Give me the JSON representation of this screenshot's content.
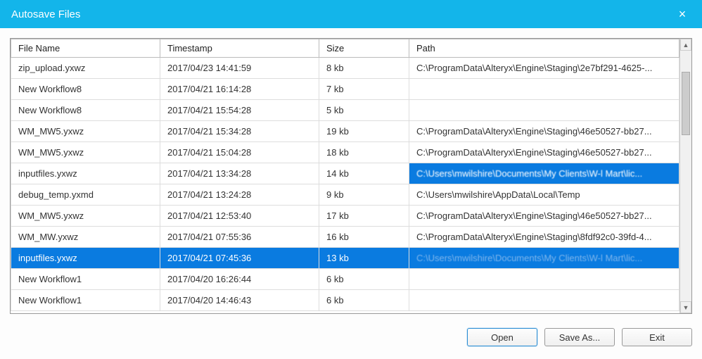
{
  "window": {
    "title": "Autosave Files",
    "close": "×"
  },
  "columns": {
    "name": "File Name",
    "timestamp": "Timestamp",
    "size": "Size",
    "path": "Path"
  },
  "rows": [
    {
      "name": "zip_upload.yxwz",
      "ts": "2017/04/23 14:41:59",
      "size": "8 kb",
      "path": "C:\\ProgramData\\Alteryx\\Engine\\Staging\\2e7bf291-4625-..."
    },
    {
      "name": "New Workflow8",
      "ts": "2017/04/21 16:14:28",
      "size": "7 kb",
      "path": ""
    },
    {
      "name": "New Workflow8",
      "ts": "2017/04/21 15:54:28",
      "size": "5 kb",
      "path": ""
    },
    {
      "name": "WM_MW5.yxwz",
      "ts": "2017/04/21 15:34:28",
      "size": "19 kb",
      "path": "C:\\ProgramData\\Alteryx\\Engine\\Staging\\46e50527-bb27..."
    },
    {
      "name": "WM_MW5.yxwz",
      "ts": "2017/04/21 15:04:28",
      "size": "18 kb",
      "path": "C:\\ProgramData\\Alteryx\\Engine\\Staging\\46e50527-bb27..."
    },
    {
      "name": "inputfiles.yxwz",
      "ts": "2017/04/21 13:34:28",
      "size": "14 kb",
      "path": "C:\\Users\\mwilshire\\Documents\\My Clients\\W-l Mart\\lic...",
      "path_selected": true
    },
    {
      "name": "debug_temp.yxmd",
      "ts": "2017/04/21 13:24:28",
      "size": "9 kb",
      "path": "C:\\Users\\mwilshire\\AppData\\Local\\Temp"
    },
    {
      "name": "WM_MW5.yxwz",
      "ts": "2017/04/21 12:53:40",
      "size": "17 kb",
      "path": "C:\\ProgramData\\Alteryx\\Engine\\Staging\\46e50527-bb27..."
    },
    {
      "name": "WM_MW.yxwz",
      "ts": "2017/04/21 07:55:36",
      "size": "16 kb",
      "path": "C:\\ProgramData\\Alteryx\\Engine\\Staging\\8fdf92c0-39fd-4..."
    },
    {
      "name": "inputfiles.yxwz",
      "ts": "2017/04/21 07:45:36",
      "size": "13 kb",
      "path": "C:\\Users\\mwilshire\\Documents\\My Clients\\W-l Mart\\lic...",
      "selected": true,
      "path_blur": true
    },
    {
      "name": "New Workflow1",
      "ts": "2017/04/20 16:26:44",
      "size": "6 kb",
      "path": ""
    },
    {
      "name": "New Workflow1",
      "ts": "2017/04/20 14:46:43",
      "size": "6 kb",
      "path": ""
    }
  ],
  "buttons": {
    "open": "Open",
    "saveas": "Save As...",
    "exit": "Exit"
  }
}
